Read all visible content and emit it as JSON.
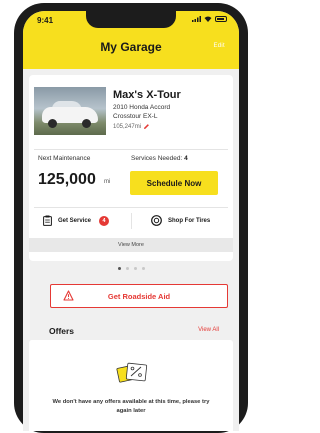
{
  "status_bar": {
    "time": "9:41"
  },
  "header": {
    "title": "My Garage",
    "edit_label": "Edit"
  },
  "vehicle": {
    "name": "Max's X-Tour",
    "model": "2010 Honda Accord",
    "trim": "Crosstour EX-L",
    "mileage": "105,247mi"
  },
  "maintenance": {
    "next_label": "Next Maintenance",
    "services_label": "Services Needed:",
    "services_count": "4",
    "miles": "125,000",
    "miles_unit": "mi",
    "schedule_label": "Schedule Now"
  },
  "actions": {
    "get_service_label": "Get Service",
    "get_service_badge": "4",
    "shop_tires_label": "Shop For Tires",
    "view_more_label": "View More"
  },
  "pagination": {
    "total": 4,
    "active": 1
  },
  "roadside": {
    "label": "Get Roadside Aid"
  },
  "offers": {
    "title": "Offers",
    "view_all_label": "View All",
    "empty_message": "We don't have any offers available at this time, please try again later"
  },
  "colors": {
    "brand_yellow": "#f7df1e",
    "alert_red": "#e53935"
  },
  "icons": [
    "signal-icon",
    "wifi-icon",
    "battery-icon",
    "pencil-icon",
    "service-clipboard-icon",
    "tire-icon",
    "warning-triangle-icon",
    "coupon-icon"
  ]
}
